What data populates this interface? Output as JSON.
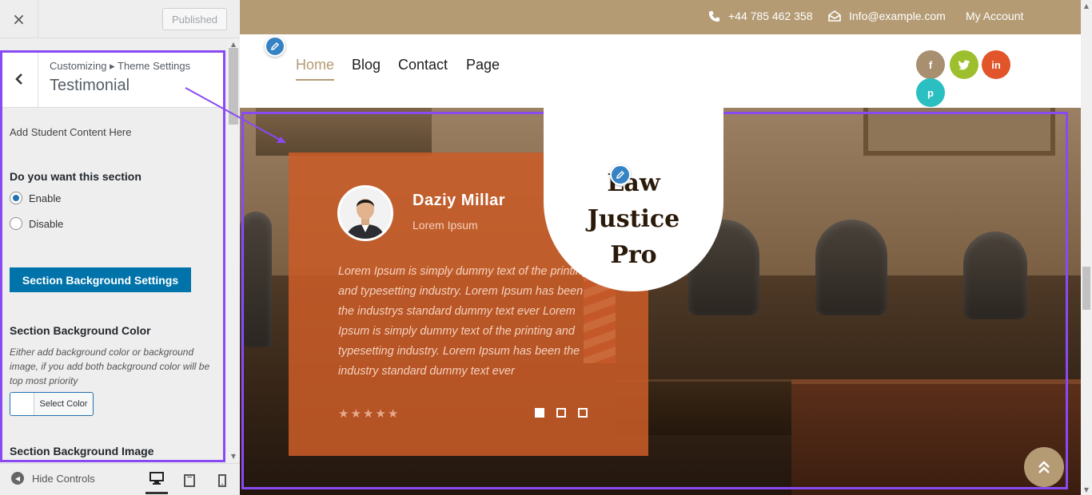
{
  "sidebar": {
    "close_icon": "×",
    "published_label": "Published",
    "breadcrumb": "Customizing ▸ Theme Settings",
    "section_title": "Testimonial",
    "back_icon": "‹",
    "add_content_text": "Add Student Content Here",
    "section_question": "Do you want this section",
    "radio_options": [
      {
        "label": "Enable",
        "checked": true
      },
      {
        "label": "Disable",
        "checked": false
      }
    ],
    "bg_settings_button": "Section Background Settings",
    "bg_color_title": "Section Background Color",
    "bg_color_description": "Either add background color or background image, if you add both background color will be top most priority",
    "select_color_label": "Select Color",
    "bg_image_title": "Section Background Image",
    "footer": {
      "hide_controls_label": "Hide Controls",
      "devices": [
        "desktop-icon",
        "tablet-icon",
        "mobile-icon"
      ]
    }
  },
  "preview": {
    "topbar": {
      "phone": "+44 785 462 358",
      "email": "Info@example.com",
      "account": "My Account"
    },
    "nav": {
      "items": [
        "Home",
        "Blog",
        "Contact",
        "Page"
      ],
      "active": "Home"
    },
    "logo_lines": [
      "Law",
      "Justice",
      "Pro"
    ],
    "social": [
      {
        "name": "facebook-icon",
        "glyph": "f",
        "color": "#a88f6f"
      },
      {
        "name": "twitter-icon",
        "glyph": "t",
        "color": "#9dbf2d"
      },
      {
        "name": "linkedin-icon",
        "glyph": "in",
        "color": "#e2542a"
      },
      {
        "name": "pinterest-icon",
        "glyph": "p",
        "color": "#2bbfc1"
      }
    ],
    "testimonial": {
      "name": "Daziy Millar",
      "role": "Lorem Ipsum",
      "text": "Lorem Ipsum is simply dummy text of the printing and typesetting industry. Lorem Ipsum has been the industrys standard dummy text ever Lorem Ipsum is simply dummy text of the printing and typesetting industry. Lorem Ipsum has been the industry standard dummy text ever",
      "rating": 5,
      "slides": 3,
      "active_slide": 1
    }
  },
  "colors": {
    "accent": "#b49b74",
    "highlight": "#8a4af3",
    "card": "#cb5c28",
    "primary_button": "#0073aa"
  }
}
